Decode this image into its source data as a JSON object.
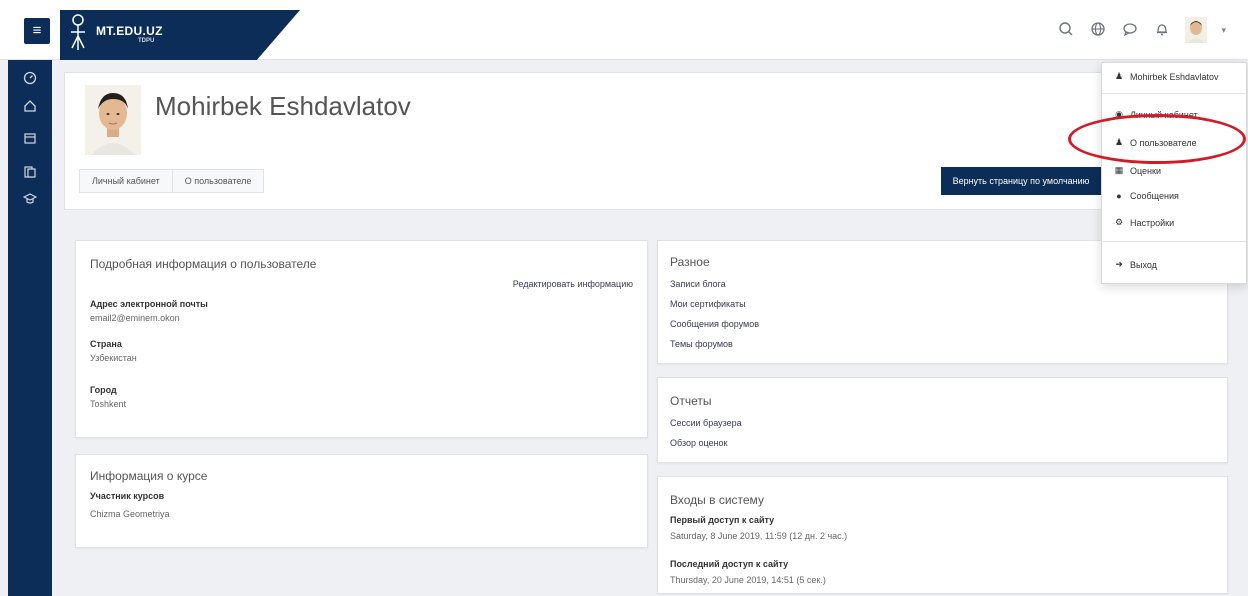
{
  "app": {
    "brand_name": "MT.EDU.UZ",
    "brand_sub": "TDPU"
  },
  "topbar": {
    "icons": [
      "search-icon",
      "globe-icon",
      "chat-icon",
      "bell-icon",
      "user-avatar",
      "caret-icon"
    ]
  },
  "sidebar": {
    "icons": [
      "dashboard-icon",
      "home-icon",
      "calendar-icon",
      "files-icon",
      "graduation-icon"
    ]
  },
  "profile": {
    "name": "Mohirbek Eshdavlatov",
    "breadcrumb": [
      "Личный кабинет",
      "О пользователе"
    ],
    "reset_button": "Вернуть страницу по умолчанию"
  },
  "details": {
    "title": "Подробная информация о пользователе",
    "edit_link": "Редактировать информацию",
    "email_label": "Адрес электронной почты",
    "email_value": "email2@eminem.okon",
    "country_label": "Страна",
    "country_value": "Узбекистан",
    "city_label": "Город",
    "city_value": "Toshkent"
  },
  "course_info": {
    "title": "Информация о курсе",
    "label": "Участник курсов",
    "value": "Chizma Geometriya"
  },
  "misc": {
    "title": "Разное",
    "links": [
      "Записи блога",
      "Мои сертификаты",
      "Сообщения форумов",
      "Темы форумов"
    ]
  },
  "reports": {
    "title": "Отчеты",
    "links": [
      "Сессии браузера",
      "Обзор оценок"
    ]
  },
  "logins": {
    "title": "Входы в систему",
    "first_label": "Первый доступ к сайту",
    "first_value": "Saturday, 8 June 2019, 11:59  (12 дн. 2 час.)",
    "last_label": "Последний доступ к сайту",
    "last_value": "Thursday, 20 June 2019, 14:51  (5 сек.)"
  },
  "user_menu": {
    "user_name": "Mohirbek Eshdavlatov",
    "dashboard": "Личный кабинет",
    "profile": "О пользователе",
    "grades": "Оценки",
    "messages": "Сообщения",
    "preferences": "Настройки",
    "logout": "Выход"
  },
  "colors": {
    "brand": "#0c2d57",
    "highlight": "#d31b28"
  }
}
